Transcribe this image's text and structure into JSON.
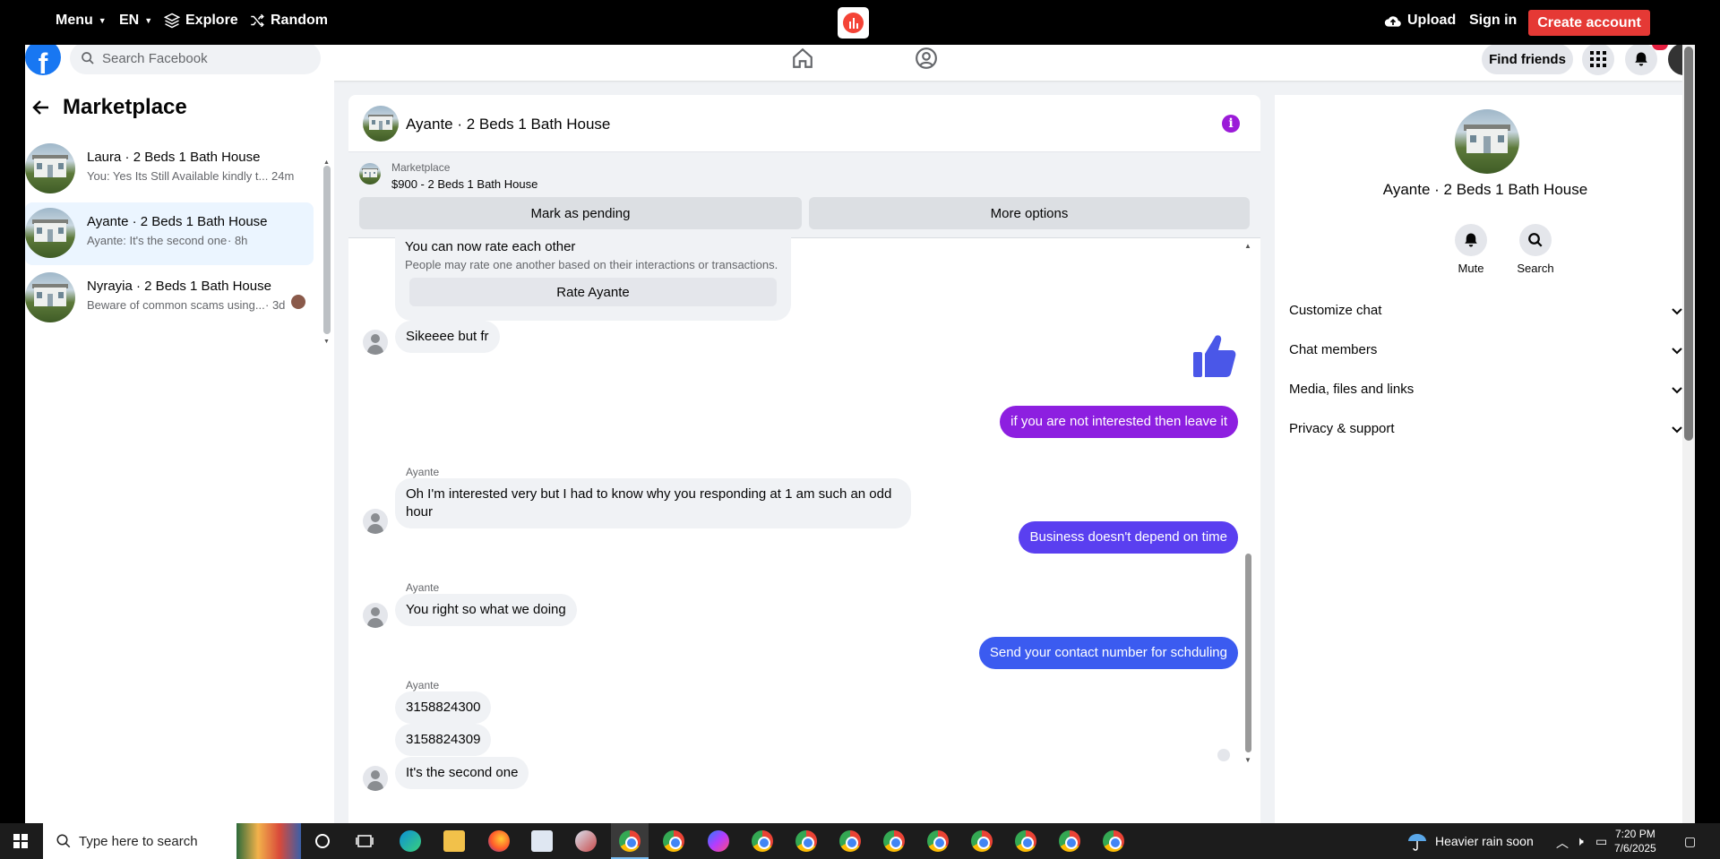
{
  "topbar": {
    "menu": "Menu",
    "lang": "EN",
    "explore": "Explore",
    "random": "Random",
    "upload": "Upload",
    "signin": "Sign in",
    "create": "Create account"
  },
  "fb": {
    "search_placeholder": "Search Facebook",
    "find_friends": "Find friends"
  },
  "sidebar": {
    "title": "Marketplace",
    "conversations": [
      {
        "name": "Laura · 2 Beds 1 Bath House",
        "preview": "You: Yes Its Still Available kindly t...",
        "time": "24m"
      },
      {
        "name": "Ayante · 2 Beds 1 Bath House",
        "preview": "Ayante: It's the second one",
        "time": "· 8h"
      },
      {
        "name": "Nyrayia · 2 Beds 1 Bath House",
        "preview": "Beware of common scams using...",
        "time": "· 3d"
      }
    ]
  },
  "chat": {
    "title": "Ayante · 2 Beds 1 Bath House",
    "marketplace_label": "Marketplace",
    "listing": "$900 - 2 Beds 1 Bath House",
    "mark_pending": "Mark as pending",
    "more_options": "More options",
    "rate_title": "You can now rate each other",
    "rate_sub": "People may rate one another based on their interactions or transactions.",
    "rate_button": "Rate Ayante",
    "sender": "Ayante",
    "messages": {
      "m1": "Sikeeee but fr",
      "m2": "if you are not interested then leave it",
      "m3": "Oh I'm interested very but I had to know why you responding at 1 am such an odd hour",
      "m4": "Business doesn't depend on time",
      "m5": "You right so what we doing",
      "m6": "Send your contact number for schduling",
      "m7": "3158824300",
      "m8": "3158824309",
      "m9": "It's the second one"
    },
    "colors": {
      "purple": "#8d1fe0",
      "violet": "#5a3ff0",
      "blue": "#3b5bf0"
    }
  },
  "info": {
    "title": "Ayante · 2 Beds 1 Bath House",
    "mute": "Mute",
    "search": "Search",
    "rows": [
      "Customize chat",
      "Chat members",
      "Media, files and links",
      "Privacy & support"
    ]
  },
  "taskbar": {
    "search_placeholder": "Type here to search",
    "weather": "Heavier rain soon",
    "time": "7:20 PM",
    "date": "7/6/2025"
  }
}
